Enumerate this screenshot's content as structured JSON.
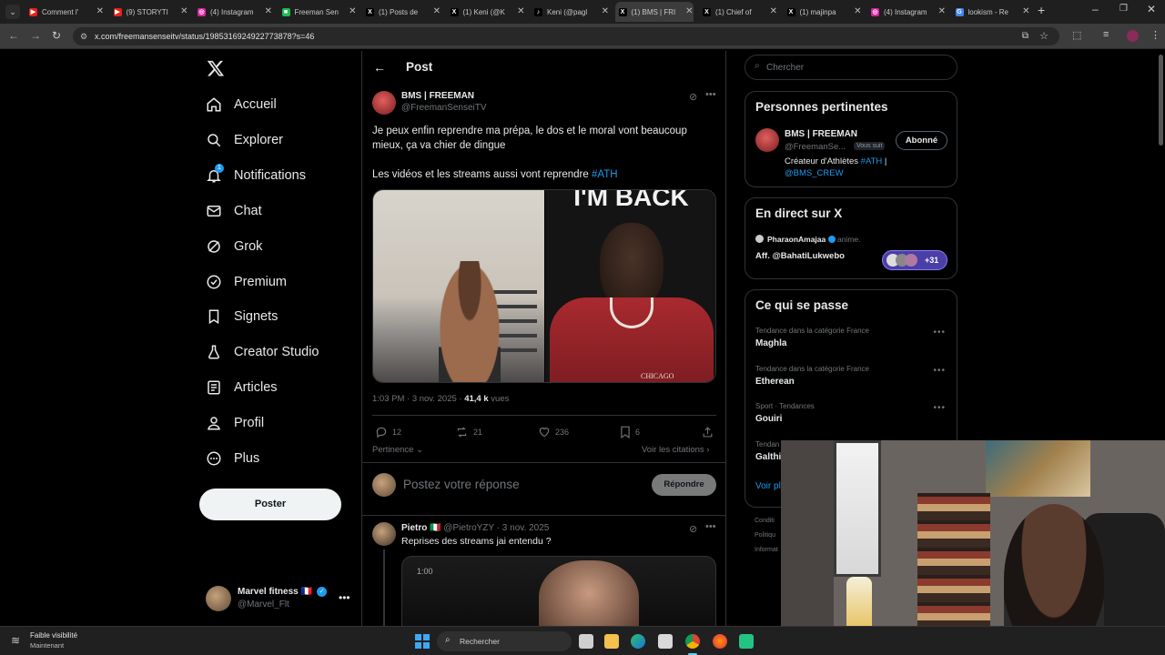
{
  "browser": {
    "tabs": [
      {
        "title": "Comment l'",
        "color": "#e62117",
        "glyph": "▶"
      },
      {
        "title": "(9) STORYTI",
        "color": "#e62117",
        "glyph": "▶"
      },
      {
        "title": "(4) Instagram",
        "color": "#d6249f",
        "glyph": "◎"
      },
      {
        "title": "Freeman Sen",
        "color": "#1db954",
        "glyph": "■"
      },
      {
        "title": "(1) Posts de",
        "color": "#000000",
        "glyph": "X"
      },
      {
        "title": "(1) Keni (@K",
        "color": "#000000",
        "glyph": "X"
      },
      {
        "title": "Keni (@pagl",
        "color": "#000000",
        "glyph": "♪"
      },
      {
        "title": "(1) BMS | FRI",
        "color": "#000000",
        "glyph": "X"
      },
      {
        "title": "(1) Chief of",
        "color": "#000000",
        "glyph": "X"
      },
      {
        "title": "(1) majinpa",
        "color": "#000000",
        "glyph": "X"
      },
      {
        "title": "(4) Instagram",
        "color": "#d6249f",
        "glyph": "◎"
      },
      {
        "title": "lookism - Re",
        "color": "#4285f4",
        "glyph": "G"
      }
    ],
    "url": "x.com/freemansenseitv/status/1985316924922773878?s=46"
  },
  "nav": {
    "items": [
      {
        "label": "Accueil",
        "icon": "home-icon"
      },
      {
        "label": "Explorer",
        "icon": "search-icon"
      },
      {
        "label": "Notifications",
        "icon": "bell-icon",
        "badge": "1"
      },
      {
        "label": "Chat",
        "icon": "mail-icon"
      },
      {
        "label": "Grok",
        "icon": "grok-icon"
      },
      {
        "label": "Premium",
        "icon": "verified-icon"
      },
      {
        "label": "Signets",
        "icon": "bookmark-icon"
      },
      {
        "label": "Creator Studio",
        "icon": "flask-icon"
      },
      {
        "label": "Articles",
        "icon": "article-icon"
      },
      {
        "label": "Profil",
        "icon": "person-icon"
      },
      {
        "label": "Plus",
        "icon": "more-circle-icon"
      }
    ],
    "post_label": "Poster",
    "account": {
      "name": "Marvel fitness 🇫🇷",
      "handle": "@Marvel_Flt"
    }
  },
  "post": {
    "header": "Post",
    "author": {
      "name": "BMS | FREEMAN",
      "handle": "@FreemanSenseiTV"
    },
    "text1": "Je peux enfin reprendre ma prépa, le dos et le moral vont beaucoup mieux, ça va chier de dingue",
    "text2": "Les vidéos et les streams aussi vont reprendre",
    "hashtag": "#ATH",
    "image_text_right": "I'M BACK",
    "image_text_jacket": "CHICAGO",
    "meta": {
      "time": "1:03 PM · 3 nov. 2025 · ",
      "views": "41,4 k",
      "views_label": " vues"
    },
    "stats": {
      "replies": "12",
      "reposts": "21",
      "likes": "236",
      "bookmarks": "6"
    },
    "sort_label": "Pertinence",
    "quotes_label": "Voir les citations",
    "reply_placeholder": "Postez votre réponse",
    "reply_button": "Répondre"
  },
  "reply": {
    "name": "Pietro 🇮🇹",
    "handle_date": "@PietroYZY · 3 nov. 2025",
    "text": "Reprises des streams jai entendu ?",
    "video_time": "1:00"
  },
  "right": {
    "search_placeholder": "Chercher",
    "people": {
      "title": "Personnes pertinentes",
      "name": "BMS | FREEMAN",
      "handle": "@FreemanSe...",
      "follows_you": "Vous suit",
      "follow_label": "Abonné",
      "bio": "Créateur d'Athlètes ",
      "bio_tag": "#ATH",
      "bio_sep": " |",
      "bio_crew": "@BMS_CREW"
    },
    "live": {
      "title": "En direct sur X",
      "host": "PharaonAmajaa",
      "host_action": " anime.",
      "space_title": "Aff. @BahatiLukwebo",
      "more": "+31"
    },
    "trends": {
      "title": "Ce qui se passe",
      "items": [
        {
          "category": "Tendance dans la catégorie France",
          "name": "Maghla"
        },
        {
          "category": "Tendance dans la catégorie France",
          "name": "Etherean"
        },
        {
          "category": "Sport · Tendances",
          "name": "Gouiri"
        },
        {
          "category": "Tendan",
          "name": "Galthi"
        }
      ],
      "show_more": "Voir pl"
    },
    "footer": [
      "Conditi",
      "Politiqu",
      "Informat"
    ]
  },
  "taskbar": {
    "weather_title": "Faible visibilité",
    "weather_sub": "Maintenant",
    "search_placeholder": "Rechercher"
  }
}
